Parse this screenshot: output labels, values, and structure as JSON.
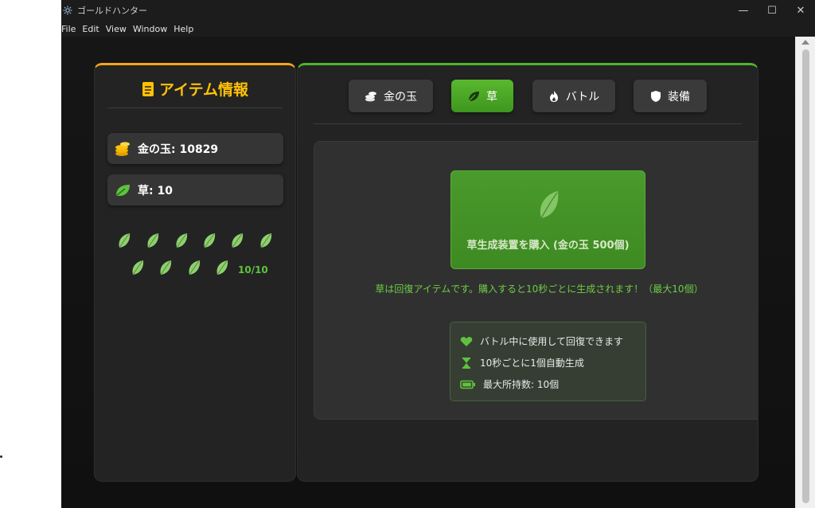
{
  "window": {
    "title": "ゴールドハンター",
    "controls": {
      "minimize": "—",
      "maximize": "☐",
      "close": "✕"
    }
  },
  "menu": [
    "File",
    "Edit",
    "View",
    "Window",
    "Help"
  ],
  "left_panel": {
    "title": "アイテム情報",
    "stats": [
      {
        "icon": "coins-icon",
        "label": "金の玉: 10829"
      },
      {
        "icon": "leaf-icon",
        "label": "草: 10"
      }
    ],
    "leaf_count_label": "10/10",
    "leaf_total": 10
  },
  "tabs": [
    {
      "icon": "coins-icon",
      "label": "金の玉",
      "active": false
    },
    {
      "icon": "leaf-icon",
      "label": "草",
      "active": true
    },
    {
      "icon": "fire-icon",
      "label": "バトル",
      "active": false
    },
    {
      "icon": "shield-icon",
      "label": "装備",
      "active": false
    }
  ],
  "grass_tab": {
    "buy_button_label": "草生成装置を購入 (金の玉 500個)",
    "description": "草は回復アイテムです。購入すると10秒ごとに生成されます！（最大10個）",
    "info": [
      {
        "icon": "heart-icon",
        "text": "バトル中に使用して回復できます"
      },
      {
        "icon": "hourglass-icon",
        "text": "10秒ごとに1個自動生成"
      },
      {
        "icon": "battery-icon",
        "text": "最大所持数: 10個"
      }
    ]
  },
  "colors": {
    "accent_gold": "#ffc107",
    "accent_green": "#4fb52a",
    "text_green": "#6ccd45"
  }
}
